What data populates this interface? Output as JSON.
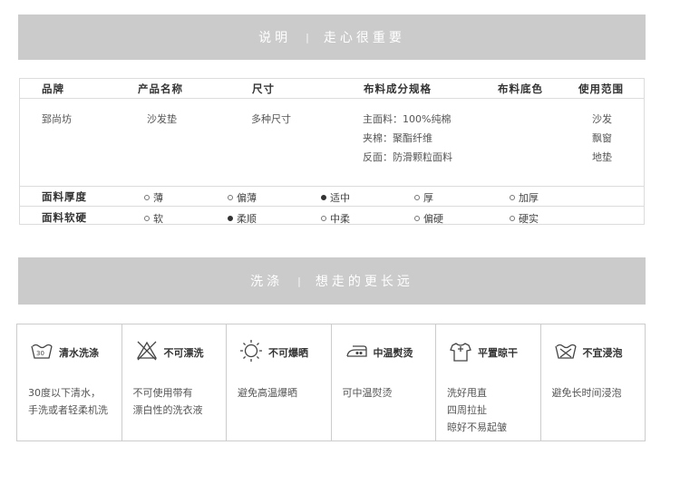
{
  "banner_info": {
    "left": "说明",
    "right": "走心很重要"
  },
  "spec": {
    "headers": [
      "品牌",
      "产品名称",
      "尺寸",
      "布料成分规格",
      "布料底色",
      "使用范围"
    ],
    "brand": "郅尚坊",
    "product": "沙发垫",
    "size": "多种尺寸",
    "composition": [
      "主面料：100%纯棉",
      "夹棉：聚酯纤维",
      "反面：防滑颗粒面料"
    ],
    "usage": [
      "沙发",
      "飘窗",
      "地垫"
    ],
    "thickness": {
      "label": "面料厚度",
      "options": [
        "薄",
        "偏薄",
        "适中",
        "厚",
        "加厚"
      ],
      "selected": "适中"
    },
    "softness": {
      "label": "面料软硬",
      "options": [
        "软",
        "柔顺",
        "中柔",
        "偏硬",
        "硬实"
      ],
      "selected": "柔顺"
    }
  },
  "banner_wash": {
    "left": "洗涤",
    "right": "想走的更长远"
  },
  "care": [
    {
      "icon": "hand-wash-icon",
      "title": "清水洗涤",
      "desc": [
        "30度以下清水，",
        "手洗或者轻柔机洗"
      ]
    },
    {
      "icon": "no-bleach-icon",
      "title": "不可漂洗",
      "desc": [
        "不可使用带有",
        "漂白性的洗衣液"
      ]
    },
    {
      "icon": "no-sun-icon",
      "title": "不可爆晒",
      "desc": [
        "避免高温爆晒"
      ]
    },
    {
      "icon": "iron-icon",
      "title": "中温熨烫",
      "desc": [
        "可中温熨烫"
      ]
    },
    {
      "icon": "flat-dry-icon",
      "title": "平置晾干",
      "desc": [
        "洗好甩直",
        "四周拉扯",
        "晾好不易起皱"
      ]
    },
    {
      "icon": "no-soak-icon",
      "title": "不宜浸泡",
      "desc": [
        "避免长时间浸泡"
      ]
    }
  ]
}
